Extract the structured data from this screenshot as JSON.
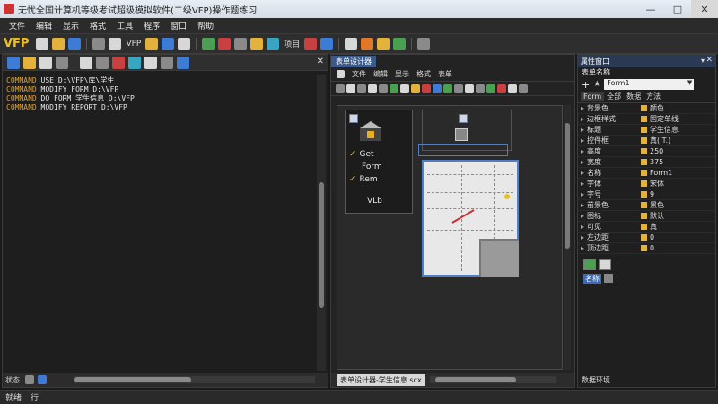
{
  "window": {
    "title": "无忧全国计算机等级考试超级模拟软件(二级VFP)操作题练习",
    "controls": [
      "—",
      "□",
      "✕"
    ]
  },
  "menubar": {
    "items": [
      "文件",
      "编辑",
      "显示",
      "格式",
      "工具",
      "程序",
      "窗口",
      "帮助"
    ]
  },
  "toolbar": {
    "logo": "VFP",
    "text_items": [
      "VFP",
      "项目"
    ]
  },
  "left_pane": {
    "commands": [
      {
        "kw": "COMMAND",
        "text": "USE D:\\VFP\\库\\学生"
      },
      {
        "kw": "COMMAND",
        "text": "MODIFY FORM D:\\VFP"
      },
      {
        "kw": "COMMAND",
        "text": "DO FORM 学生信息 D:\\VFP"
      },
      {
        "kw": "COMMAND",
        "text": "MODIFY REPORT D:\\VFP"
      }
    ],
    "bottom_label": "状态"
  },
  "mid_pane": {
    "tab_label": "表单设计器",
    "menu_items": [
      "文件",
      "编辑",
      "显示",
      "格式",
      "表单"
    ],
    "control_options": [
      {
        "checked": true,
        "label": "Get"
      },
      {
        "checked": false,
        "label": "Form"
      },
      {
        "checked": true,
        "label": "Rem"
      },
      {
        "checked": false,
        "label": "VLb"
      }
    ],
    "bottom_tab": "表单设计器-学生信息.scx"
  },
  "right_pane": {
    "title": "属性窗口",
    "subtitle": "表单名称",
    "combo_value": "Form1",
    "tabs": [
      "Form",
      "全部",
      "数据",
      "方法"
    ],
    "properties": [
      {
        "name": "背景色",
        "value": "颜色"
      },
      {
        "name": "边框样式",
        "value": "固定单线"
      },
      {
        "name": "标题",
        "value": "学生信息"
      },
      {
        "name": "控件框",
        "value": "真(.T.)"
      },
      {
        "name": "高度",
        "value": "250"
      },
      {
        "name": "宽度",
        "value": "375"
      },
      {
        "name": "名称",
        "value": "Form1"
      },
      {
        "name": "字体",
        "value": "宋体"
      },
      {
        "name": "字号",
        "value": "9"
      },
      {
        "name": "前景色",
        "value": "黑色"
      },
      {
        "name": "图标",
        "value": "默认"
      },
      {
        "name": "可见",
        "value": "真"
      },
      {
        "name": "左边距",
        "value": "0"
      },
      {
        "name": "顶边距",
        "value": "0"
      }
    ],
    "status_label": "名称",
    "footer": "数据环境"
  },
  "statusbar": {
    "items": [
      "就绪",
      "行"
    ]
  }
}
